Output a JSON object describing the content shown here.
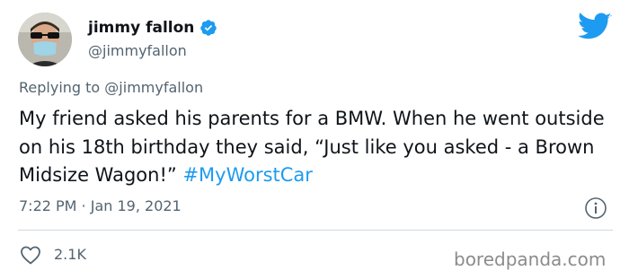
{
  "tweet": {
    "display_name": "jimmy fallon",
    "handle": "@jimmyfallon",
    "replying_prefix": "Replying to",
    "replying_handle": "@jimmyfallon",
    "text": "My friend asked his parents for a BMW. When he went outside on his 18th birthday they said, “Just like you asked - a Brown Midsize Wagon!” ",
    "hashtag": "#MyWorstCar",
    "timestamp": "7:22 PM · Jan 19, 2021",
    "likes": "2.1K"
  },
  "icons": {
    "verified": "verified-badge-icon",
    "brand": "twitter-bird-icon",
    "info": "info-icon",
    "like": "heart-icon"
  },
  "colors": {
    "accent": "#1d9bf0",
    "text": "#0f1419",
    "muted": "#536471",
    "divider": "#cfd9de",
    "watermark": "#8b8b8b"
  },
  "watermark": "boredpanda.com"
}
